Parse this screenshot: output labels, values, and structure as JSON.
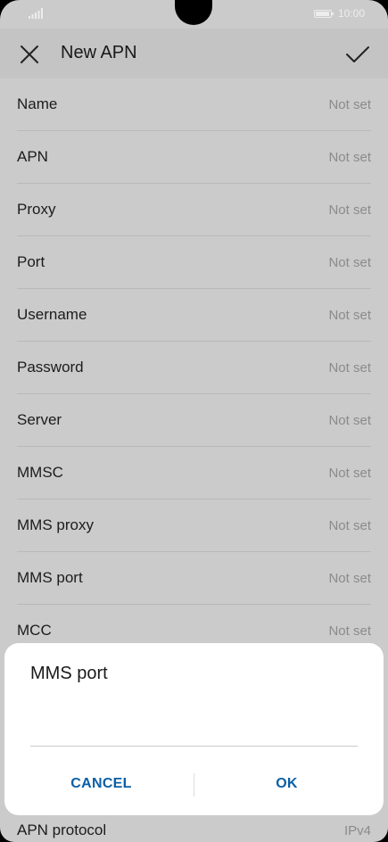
{
  "status_bar": {
    "time": "10:00"
  },
  "app_bar": {
    "title": "New APN"
  },
  "fields": [
    {
      "label": "Name",
      "value": "Not set"
    },
    {
      "label": "APN",
      "value": "Not set"
    },
    {
      "label": "Proxy",
      "value": "Not set"
    },
    {
      "label": "Port",
      "value": "Not set"
    },
    {
      "label": "Username",
      "value": "Not set"
    },
    {
      "label": "Password",
      "value": "Not set"
    },
    {
      "label": "Server",
      "value": "Not set"
    },
    {
      "label": "MMSC",
      "value": "Not set"
    },
    {
      "label": "MMS proxy",
      "value": "Not set"
    },
    {
      "label": "MMS port",
      "value": "Not set"
    },
    {
      "label": "MCC",
      "value": "Not set"
    }
  ],
  "last_field": {
    "label": "APN protocol",
    "value": "IPv4"
  },
  "dialog": {
    "title": "MMS port",
    "input_value": "",
    "cancel_label": "CANCEL",
    "ok_label": "OK",
    "accent_color": "#0b5fa6"
  },
  "icons": {
    "close": "close-icon",
    "confirm": "checkmark-icon",
    "signal": "signal-icon",
    "battery": "battery-icon"
  }
}
